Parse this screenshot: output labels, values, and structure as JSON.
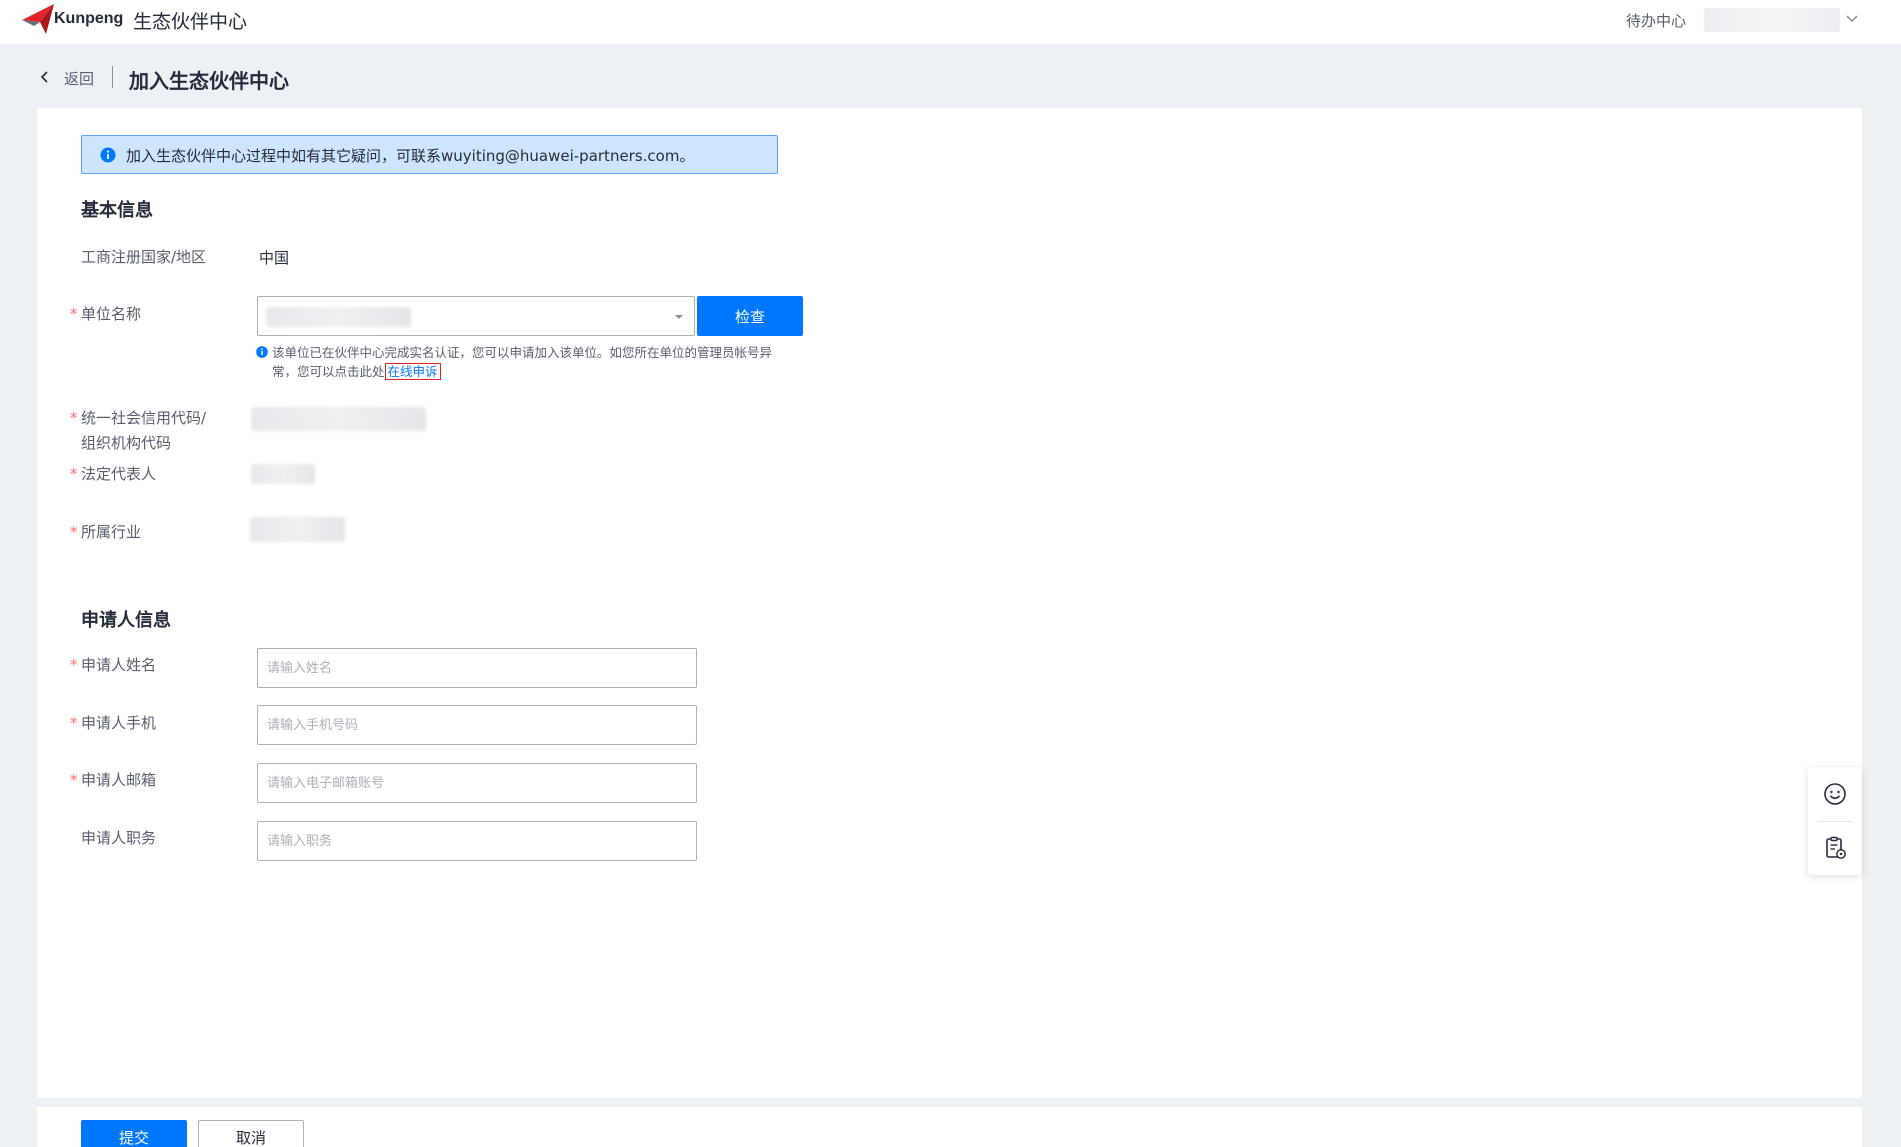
{
  "header": {
    "brand": "Kunpeng",
    "portal_name": "生态伙伴中心",
    "todo_label": "待办中心",
    "logo_color": "#e0242d"
  },
  "breadcrumb": {
    "back_label": "返回",
    "title": "加入生态伙伴中心"
  },
  "notice": {
    "text": "加入生态伙伴中心过程中如有其它疑问，可联系wuyiting@huawei-partners.com。"
  },
  "basic_info": {
    "section_title": "基本信息",
    "country_label": "工商注册国家/地区",
    "country_value": "中国",
    "unit_name_label": "单位名称",
    "check_button": "检查",
    "hint_text": "该单位已在伙伴中心完成实名认证，您可以申请加入该单位。如您所在单位的管理员帐号异常，您可以点击此处",
    "appeal_link": "在线申诉",
    "credit_code_label_line1": "统一社会信用代码/",
    "credit_code_label_line2": "组织机构代码",
    "legal_rep_label": "法定代表人",
    "industry_label": "所属行业"
  },
  "applicant_info": {
    "section_title": "申请人信息",
    "name_label": "申请人姓名",
    "name_placeholder": "请输入姓名",
    "phone_label": "申请人手机",
    "phone_placeholder": "请输入手机号码",
    "email_label": "申请人邮箱",
    "email_placeholder": "请输入电子邮箱账号",
    "position_label": "申请人职务",
    "position_placeholder": "请输入职务"
  },
  "footer": {
    "submit_label": "提交",
    "cancel_label": "取消"
  },
  "colors": {
    "primary": "#0077ff",
    "required": "#f66f6a",
    "notice_bg": "#cde6fd"
  },
  "icons": {
    "logo": "kunpeng-logo-icon",
    "back": "chevron-left-icon",
    "info": "info-icon",
    "feedback": "smiley-icon",
    "clipboard": "clipboard-settings-icon"
  }
}
